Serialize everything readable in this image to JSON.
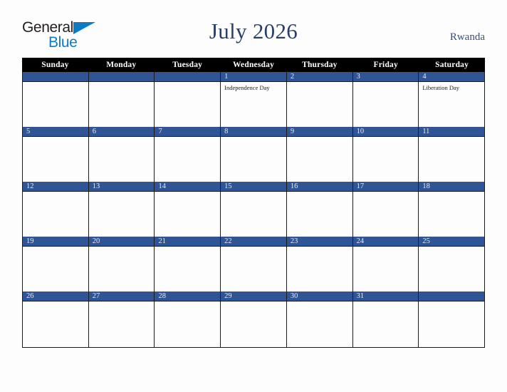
{
  "brand": {
    "name_part1": "General",
    "name_part2": "Blue",
    "triangle_icon": "blue-triangle-icon",
    "color_dark": "#231f20",
    "color_blue": "#0e7ac4"
  },
  "header": {
    "title": "July 2026",
    "country": "Rwanda",
    "title_color": "#2b3f66"
  },
  "calendar": {
    "month": "July",
    "year": "2026",
    "accent_color": "#2f5596",
    "header_bg": "#000000",
    "weekday_headers": [
      "Sunday",
      "Monday",
      "Tuesday",
      "Wednesday",
      "Thursday",
      "Friday",
      "Saturday"
    ],
    "weeks": [
      [
        {
          "day": "",
          "events": []
        },
        {
          "day": "",
          "events": []
        },
        {
          "day": "",
          "events": []
        },
        {
          "day": "1",
          "events": [
            "Independence Day"
          ]
        },
        {
          "day": "2",
          "events": []
        },
        {
          "day": "3",
          "events": []
        },
        {
          "day": "4",
          "events": [
            "Liberation Day"
          ]
        }
      ],
      [
        {
          "day": "5",
          "events": []
        },
        {
          "day": "6",
          "events": []
        },
        {
          "day": "7",
          "events": []
        },
        {
          "day": "8",
          "events": []
        },
        {
          "day": "9",
          "events": []
        },
        {
          "day": "10",
          "events": []
        },
        {
          "day": "11",
          "events": []
        }
      ],
      [
        {
          "day": "12",
          "events": []
        },
        {
          "day": "13",
          "events": []
        },
        {
          "day": "14",
          "events": []
        },
        {
          "day": "15",
          "events": []
        },
        {
          "day": "16",
          "events": []
        },
        {
          "day": "17",
          "events": []
        },
        {
          "day": "18",
          "events": []
        }
      ],
      [
        {
          "day": "19",
          "events": []
        },
        {
          "day": "20",
          "events": []
        },
        {
          "day": "21",
          "events": []
        },
        {
          "day": "22",
          "events": []
        },
        {
          "day": "23",
          "events": []
        },
        {
          "day": "24",
          "events": []
        },
        {
          "day": "25",
          "events": []
        }
      ],
      [
        {
          "day": "26",
          "events": []
        },
        {
          "day": "27",
          "events": []
        },
        {
          "day": "28",
          "events": []
        },
        {
          "day": "29",
          "events": []
        },
        {
          "day": "30",
          "events": []
        },
        {
          "day": "31",
          "events": []
        },
        {
          "day": "",
          "events": []
        }
      ]
    ]
  }
}
